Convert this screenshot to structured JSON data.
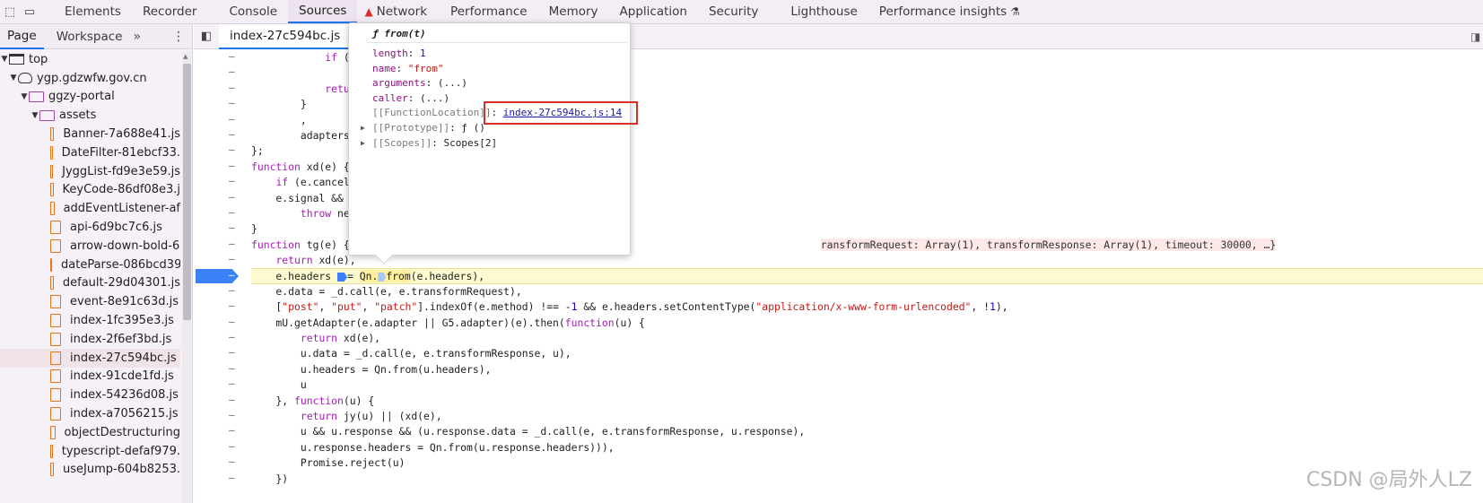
{
  "topbar": {
    "tabs": [
      {
        "label": "Elements",
        "active": false
      },
      {
        "label": "Recorder",
        "active": false
      },
      {
        "label": "Console",
        "active": false
      },
      {
        "label": "Sources",
        "active": true
      },
      {
        "label": "Network",
        "active": false
      },
      {
        "label": "Performance",
        "active": false
      },
      {
        "label": "Memory",
        "active": false
      },
      {
        "label": "Application",
        "active": false
      },
      {
        "label": "Security",
        "active": false
      },
      {
        "label": "Lighthouse",
        "active": false
      },
      {
        "label": "Performance insights",
        "active": false
      }
    ]
  },
  "navigator": {
    "tabs": [
      "Page",
      "Workspace"
    ],
    "tree": [
      {
        "label": "top",
        "type": "frame",
        "depth": 0
      },
      {
        "label": "ygp.gdzwfw.gov.cn",
        "type": "cloud",
        "depth": 1
      },
      {
        "label": "ggzy-portal",
        "type": "folder",
        "depth": 2
      },
      {
        "label": "assets",
        "type": "folder",
        "depth": 3
      },
      {
        "label": "Banner-7a688e41.js",
        "type": "file",
        "depth": 4
      },
      {
        "label": "DateFilter-81ebcf33.",
        "type": "file",
        "depth": 4
      },
      {
        "label": "JyggList-fd9e3e59.js",
        "type": "file",
        "depth": 4
      },
      {
        "label": "KeyCode-86df08e3.j",
        "type": "file",
        "depth": 4
      },
      {
        "label": "addEventListener-af",
        "type": "file",
        "depth": 4
      },
      {
        "label": "api-6d9bc7c6.js",
        "type": "file",
        "depth": 4
      },
      {
        "label": "arrow-down-bold-6",
        "type": "file",
        "depth": 4
      },
      {
        "label": "dateParse-086bcd39",
        "type": "file",
        "depth": 4
      },
      {
        "label": "default-29d04301.js",
        "type": "file",
        "depth": 4
      },
      {
        "label": "event-8e91c63d.js",
        "type": "file",
        "depth": 4
      },
      {
        "label": "index-1fc395e3.js",
        "type": "file",
        "depth": 4
      },
      {
        "label": "index-2f6ef3bd.js",
        "type": "file",
        "depth": 4
      },
      {
        "label": "index-27c594bc.js",
        "type": "file",
        "depth": 4,
        "selected": true
      },
      {
        "label": "index-91cde1fd.js",
        "type": "file",
        "depth": 4
      },
      {
        "label": "index-54236d08.js",
        "type": "file",
        "depth": 4
      },
      {
        "label": "index-a7056215.js",
        "type": "file",
        "depth": 4
      },
      {
        "label": "objectDestructuring",
        "type": "file",
        "depth": 4
      },
      {
        "label": "typescript-defaf979.",
        "type": "file",
        "depth": 4
      },
      {
        "label": "useJump-604b8253.",
        "type": "file",
        "depth": 4
      }
    ]
  },
  "editor": {
    "tab_label": "index-27c594bc.js",
    "code_lines": [
      {
        "indent": 12,
        "text": "if (!t.i"
      },
      {
        "indent": 16,
        "text": "thro"
      },
      {
        "indent": 12,
        "text": "return u"
      },
      {
        "indent": 8,
        "text": "}"
      },
      {
        "indent": 8,
        "text": ","
      },
      {
        "indent": 8,
        "text": "adapters: Sa"
      },
      {
        "indent": 0,
        "text": "};"
      },
      {
        "indent": 0,
        "text": "function xd(e) {"
      },
      {
        "indent": 4,
        "text": "if (e.cancel"
      },
      {
        "indent": 4,
        "text": "e.signal &&"
      },
      {
        "indent": 8,
        "text": "throw ne"
      },
      {
        "indent": 0,
        "text": "}"
      },
      {
        "indent": 0,
        "text": "function tg(e) {"
      },
      {
        "indent": 4,
        "text": "return xd(e),"
      },
      {
        "indent": 4,
        "text": "e.headers = Qn.from(e.headers),"
      },
      {
        "indent": 4,
        "text": "e.data = _d.call(e, e.transformRequest),"
      },
      {
        "indent": 4,
        "text": "[\"post\", \"put\", \"patch\"].indexOf(e.method) !== -1 && e.headers.setContentType(\"application/x-www-form-urlencoded\", !1),"
      },
      {
        "indent": 4,
        "text": "mU.getAdapter(e.adapter || G5.adapter)(e).then(function(u) {"
      },
      {
        "indent": 8,
        "text": "return xd(e),"
      },
      {
        "indent": 8,
        "text": "u.data = _d.call(e, e.transformResponse, u),"
      },
      {
        "indent": 8,
        "text": "u.headers = Qn.from(u.headers),"
      },
      {
        "indent": 8,
        "text": "u"
      },
      {
        "indent": 4,
        "text": "}, function(u) {"
      },
      {
        "indent": 8,
        "text": "return jy(u) || (xd(e),"
      },
      {
        "indent": 8,
        "text": "u && u.response && (u.response.data = _d.call(e, e.transformResponse, u.response),"
      },
      {
        "indent": 8,
        "text": "u.response.headers = Qn.from(u.response.headers))),"
      },
      {
        "indent": 8,
        "text": "Promise.reject(u)"
      },
      {
        "indent": 4,
        "text": "})"
      }
    ],
    "inline_value_tg": "ransformRequest: Array(1), transformResponse: Array(1), timeout: 30000, …}"
  },
  "popover": {
    "title": "ƒ from(t)",
    "properties": [
      {
        "key": "length",
        "value": "1",
        "kind": "number"
      },
      {
        "key": "name",
        "value": "\"from\"",
        "kind": "string"
      },
      {
        "key": "arguments",
        "value": "(...)",
        "kind": "plain"
      },
      {
        "key": "caller",
        "value": "(...)",
        "kind": "plain"
      },
      {
        "key": "[[FunctionLocation]]",
        "value": "index-27c594bc.js:14",
        "kind": "link"
      },
      {
        "key": "[[Prototype]]",
        "value": "ƒ ()",
        "kind": "plain",
        "expandable": true
      },
      {
        "key": "[[Scopes]]",
        "value": "Scopes[2]",
        "kind": "plain",
        "expandable": true
      }
    ]
  },
  "watermark": "CSDN @局外人LZ",
  "colors": {
    "accent": "#1a73e8",
    "breakpoint": "#3b82f6",
    "highlight_box": "#d93025"
  }
}
